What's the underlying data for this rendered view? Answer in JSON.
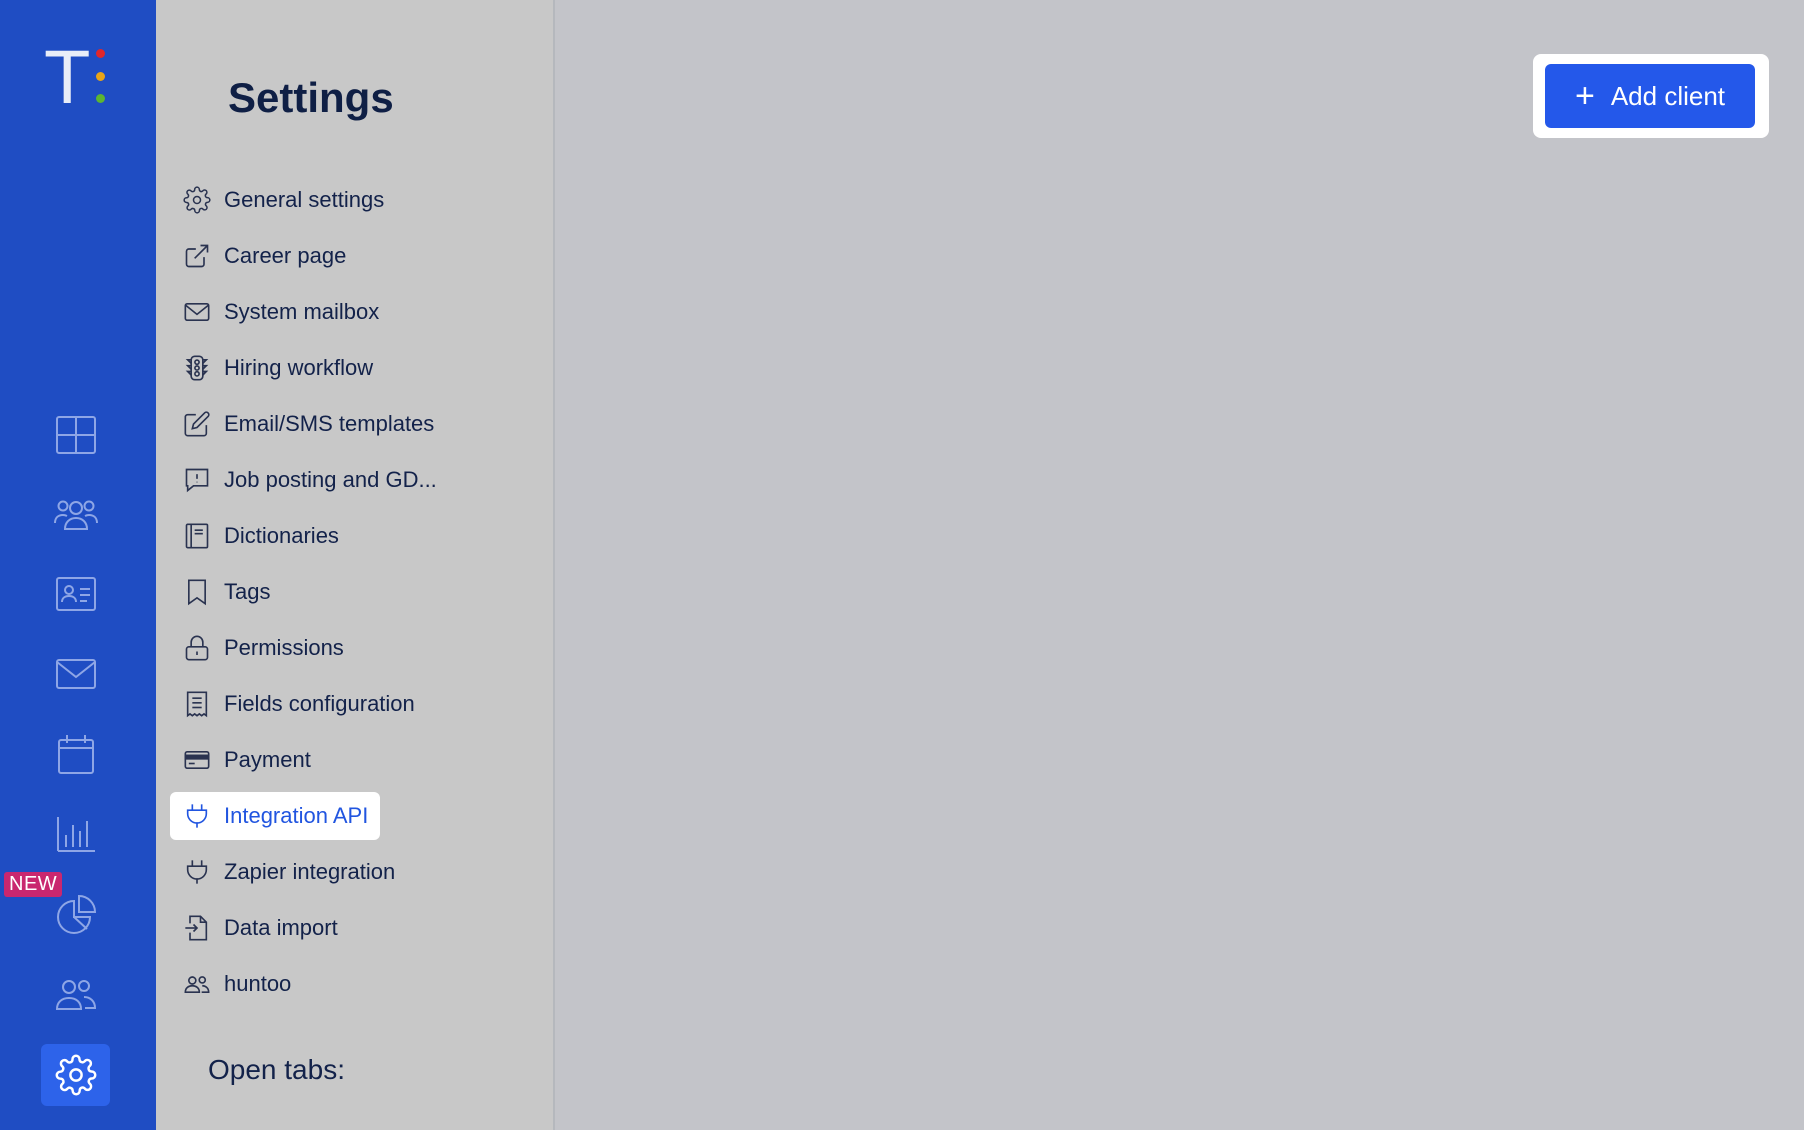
{
  "logo": {
    "letter": "T",
    "dot_colors": [
      "#e0262b",
      "#e8a417",
      "#5cb531"
    ]
  },
  "rail": {
    "items": [
      {
        "icon": "dashboard-grid-icon"
      },
      {
        "icon": "team-icon"
      },
      {
        "icon": "contact-card-icon"
      },
      {
        "icon": "mail-icon"
      },
      {
        "icon": "calendar-icon"
      },
      {
        "icon": "bar-chart-icon"
      },
      {
        "icon": "pie-chart-icon"
      },
      {
        "icon": "users-icon"
      },
      {
        "icon": "gear-icon"
      }
    ],
    "new_badge": "NEW"
  },
  "settings": {
    "title": "Settings",
    "items": [
      {
        "label": "General settings",
        "icon": "gear-icon"
      },
      {
        "label": "Career page",
        "icon": "external-link-icon"
      },
      {
        "label": "System mailbox",
        "icon": "mail-icon"
      },
      {
        "label": "Hiring workflow",
        "icon": "traffic-light-icon"
      },
      {
        "label": "Email/SMS templates",
        "icon": "edit-icon"
      },
      {
        "label": "Job posting and GD...",
        "icon": "alert-message-icon"
      },
      {
        "label": "Dictionaries",
        "icon": "book-icon"
      },
      {
        "label": "Tags",
        "icon": "bookmark-icon"
      },
      {
        "label": "Permissions",
        "icon": "lock-icon"
      },
      {
        "label": "Fields configuration",
        "icon": "receipt-icon"
      },
      {
        "label": "Payment",
        "icon": "credit-card-icon"
      },
      {
        "label": "Integration API",
        "icon": "plug-icon",
        "active": true
      },
      {
        "label": "Zapier integration",
        "icon": "plug-icon"
      },
      {
        "label": "Data import",
        "icon": "file-import-icon"
      },
      {
        "label": "huntoo",
        "icon": "users-icon"
      }
    ],
    "open_tabs_label": "Open tabs:"
  },
  "toolbar": {
    "add_client_label": "Add client",
    "add_icon": "plus-icon"
  },
  "colors": {
    "rail": "#1f4dc3",
    "accent": "#2458ea",
    "panel": "#c8c8c8",
    "content": "#c3c4c9",
    "badge": "#c9276f"
  }
}
